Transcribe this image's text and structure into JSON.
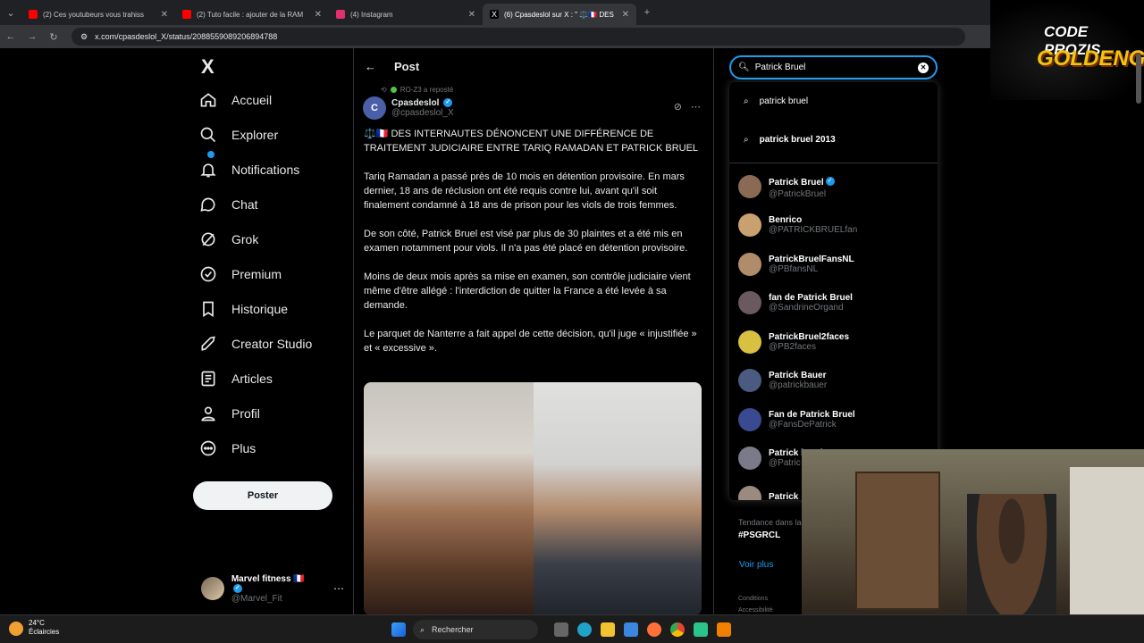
{
  "browser": {
    "tabs": [
      {
        "title": "(2) Ces youtubeurs vous trahiss",
        "favicon_color": "#ff0000"
      },
      {
        "title": "(2) Tuto facile : ajouter de la RAM",
        "favicon_color": "#ff0000"
      },
      {
        "title": "(4) Instagram",
        "favicon_color": "#e1306c"
      },
      {
        "title": "(6) Cpasdeslol sur X : \" ⚖️🇫🇷 DES",
        "favicon_color": "#ffffff",
        "active": true
      }
    ],
    "url": "x.com/cpasdeslol_X/status/2088559089206894788"
  },
  "sidebar": {
    "logo": "X",
    "items": [
      {
        "label": "Accueil",
        "icon": "home-icon"
      },
      {
        "label": "Explorer",
        "icon": "search-icon"
      },
      {
        "label": "Notifications",
        "icon": "bell-icon"
      },
      {
        "label": "Chat",
        "icon": "chat-icon"
      },
      {
        "label": "Grok",
        "icon": "grok-icon"
      },
      {
        "label": "Premium",
        "icon": "premium-icon"
      },
      {
        "label": "Historique",
        "icon": "bookmark-icon"
      },
      {
        "label": "Creator Studio",
        "icon": "rocket-icon"
      },
      {
        "label": "Articles",
        "icon": "article-icon"
      },
      {
        "label": "Profil",
        "icon": "person-icon"
      },
      {
        "label": "Plus",
        "icon": "more-circle-icon"
      }
    ],
    "post_button": "Poster",
    "account": {
      "name": "Marvel fitness 🇫🇷",
      "handle": "@Marvel_Fit"
    }
  },
  "main": {
    "header": "Post",
    "repost_label": "RO-Z3 a reposté",
    "author": {
      "name": "Cpasdeslol",
      "handle": "@cpasdeslol_X",
      "initial": "C"
    },
    "paragraphs": [
      "⚖️🇫🇷 DES INTERNAUTES DÉNONCENT UNE DIFFÉRENCE DE TRAITEMENT JUDICIAIRE ENTRE TARIQ RAMADAN ET PATRICK BRUEL",
      "Tariq Ramadan a passé près de 10 mois en détention provisoire. En mars dernier, 18 ans de réclusion ont été requis contre lui, avant qu'il soit finalement condamné à 18 ans de prison pour les viols de trois femmes.",
      "De son côté, Patrick Bruel est visé par plus de 30 plaintes et a été mis en examen notamment pour viols. Il n'a pas été placé en détention provisoire.",
      "Moins de deux mois après sa mise en examen, son contrôle judiciaire vient même d'être allégé : l'interdiction de quitter la France a été levée à sa demande.",
      "Le parquet de Nanterre a fait appel de cette décision, qu'il juge « injustifiée » et « excessive »."
    ]
  },
  "search": {
    "value": "Patrick Bruel",
    "suggestions": [
      "patrick bruel",
      "patrick bruel 2013"
    ],
    "users": [
      {
        "name": "Patrick Bruel",
        "handle": "@PatrickBruel",
        "verified": true,
        "color": "#8a6a55"
      },
      {
        "name": "Benrico",
        "handle": "@PATRICKBRUELfan",
        "verified": false,
        "color": "#c9a070"
      },
      {
        "name": "PatrickBruelFansNL",
        "handle": "@PBfansNL",
        "verified": false,
        "color": "#b08c6a"
      },
      {
        "name": "fan de Patrick Bruel",
        "handle": "@SandrineOrgand",
        "verified": false,
        "color": "#6a5a60"
      },
      {
        "name": "PatrickBruel2faces",
        "handle": "@PB2faces",
        "verified": false,
        "color": "#d8c040"
      },
      {
        "name": "Patrick Bauer",
        "handle": "@patrickbauer",
        "verified": false,
        "color": "#4a5a80"
      },
      {
        "name": "Fan de Patrick Bruel",
        "handle": "@FansDePatrick",
        "verified": false,
        "color": "#3a4a90"
      },
      {
        "name": "Patrick bruel",
        "handle": "@Patric",
        "verified": false,
        "color": "#7a7a8a"
      },
      {
        "name": "Patrick",
        "handle": "",
        "verified": false,
        "color": "#9a8a80"
      }
    ]
  },
  "trends": {
    "category": "Tendance dans la",
    "tag": "#PSGRCL",
    "see_more": "Voir plus",
    "footer": [
      "Conditions",
      "Accessibilité"
    ]
  },
  "overlay": {
    "line1": "CODE PROZIS",
    "line2": "GOLDENG"
  },
  "taskbar": {
    "temp": "24°C",
    "weather": "Éclaircies",
    "search": "Rechercher"
  }
}
